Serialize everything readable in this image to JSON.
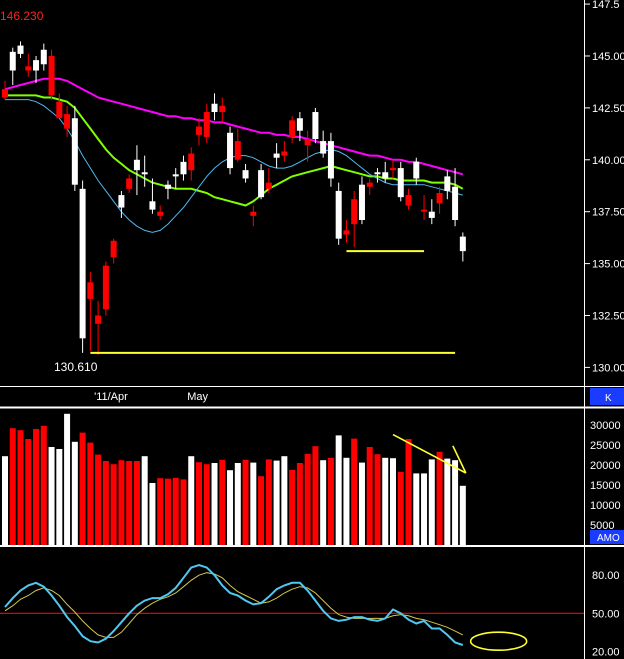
{
  "chart_data": [
    {
      "type": "candlestick",
      "title": "",
      "y_ticks": [
        "147.5",
        "145.00",
        "142.50",
        "140.00",
        "137.50",
        "135.00",
        "132.50",
        "130.00"
      ],
      "y_tick_values": [
        147.5,
        145.0,
        142.5,
        140.0,
        137.5,
        135.0,
        132.5,
        130.0
      ],
      "ylim": [
        129.2,
        147.6
      ],
      "x_labels": [
        "'11/Apr",
        "May"
      ],
      "x_label_bars": [
        12,
        24
      ],
      "annotations": {
        "high": "146.230",
        "low": "130.610"
      },
      "candles": [
        {
          "o": 143.4,
          "h": 143.8,
          "l": 142.9,
          "c": 143.0,
          "up": false
        },
        {
          "o": 144.3,
          "h": 145.4,
          "l": 143.6,
          "c": 145.2,
          "up": true
        },
        {
          "o": 145.1,
          "h": 145.7,
          "l": 144.9,
          "c": 145.5,
          "up": true
        },
        {
          "o": 144.3,
          "h": 145.1,
          "l": 144.0,
          "c": 144.5,
          "up": false
        },
        {
          "o": 144.3,
          "h": 145.0,
          "l": 143.7,
          "c": 144.8,
          "up": true
        },
        {
          "o": 144.6,
          "h": 145.6,
          "l": 144.3,
          "c": 145.3,
          "up": true
        },
        {
          "o": 145.0,
          "h": 145.3,
          "l": 142.9,
          "c": 143.1,
          "up": false
        },
        {
          "o": 142.8,
          "h": 143.2,
          "l": 142.7,
          "c": 142.0,
          "up": false
        },
        {
          "o": 142.2,
          "h": 142.6,
          "l": 141.1,
          "c": 141.5,
          "up": false
        },
        {
          "o": 142.0,
          "h": 142.6,
          "l": 138.5,
          "c": 138.8,
          "up": true
        },
        {
          "o": 138.6,
          "h": 139.0,
          "l": 130.7,
          "c": 131.4,
          "up": true
        },
        {
          "o": 134.1,
          "h": 134.6,
          "l": 130.8,
          "c": 133.3,
          "up": false
        },
        {
          "o": 132.5,
          "h": 133.2,
          "l": 130.6,
          "c": 132.1,
          "up": false
        },
        {
          "o": 132.8,
          "h": 135.1,
          "l": 132.5,
          "c": 134.9,
          "up": false
        },
        {
          "o": 135.3,
          "h": 136.2,
          "l": 135.0,
          "c": 136.1,
          "up": false
        },
        {
          "o": 137.7,
          "h": 138.5,
          "l": 137.2,
          "c": 138.3,
          "up": true
        },
        {
          "o": 138.6,
          "h": 139.3,
          "l": 138.4,
          "c": 139.1,
          "up": false
        },
        {
          "o": 140.0,
          "h": 140.7,
          "l": 138.3,
          "c": 139.5,
          "up": true
        },
        {
          "o": 139.3,
          "h": 140.2,
          "l": 138.7,
          "c": 139.4,
          "up": true
        },
        {
          "o": 138.0,
          "h": 139.1,
          "l": 137.4,
          "c": 137.6,
          "up": true
        },
        {
          "o": 137.5,
          "h": 137.8,
          "l": 137.1,
          "c": 137.3,
          "up": false
        },
        {
          "o": 138.6,
          "h": 139.0,
          "l": 138.1,
          "c": 138.8,
          "up": true
        },
        {
          "o": 139.2,
          "h": 139.6,
          "l": 138.6,
          "c": 139.3,
          "up": true
        },
        {
          "o": 139.3,
          "h": 140.2,
          "l": 139.0,
          "c": 139.9,
          "up": true
        },
        {
          "o": 139.5,
          "h": 140.6,
          "l": 139.0,
          "c": 140.3,
          "up": false
        },
        {
          "o": 141.2,
          "h": 142.0,
          "l": 140.7,
          "c": 141.6,
          "up": false
        },
        {
          "o": 141.1,
          "h": 142.7,
          "l": 140.8,
          "c": 142.3,
          "up": false
        },
        {
          "o": 142.3,
          "h": 143.2,
          "l": 141.9,
          "c": 142.7,
          "up": true
        },
        {
          "o": 142.6,
          "h": 143.0,
          "l": 141.8,
          "c": 142.3,
          "up": false
        },
        {
          "o": 139.6,
          "h": 141.6,
          "l": 139.3,
          "c": 141.3,
          "up": true
        },
        {
          "o": 140.9,
          "h": 141.5,
          "l": 139.9,
          "c": 140.0,
          "up": false
        },
        {
          "o": 139.1,
          "h": 139.8,
          "l": 138.9,
          "c": 139.5,
          "up": true
        },
        {
          "o": 137.5,
          "h": 137.8,
          "l": 136.8,
          "c": 137.3,
          "up": false
        },
        {
          "o": 138.2,
          "h": 139.8,
          "l": 138.1,
          "c": 139.5,
          "up": true
        },
        {
          "o": 138.9,
          "h": 139.6,
          "l": 138.4,
          "c": 138.6,
          "up": false
        },
        {
          "o": 140.1,
          "h": 140.8,
          "l": 139.6,
          "c": 140.3,
          "up": true
        },
        {
          "o": 140.4,
          "h": 140.9,
          "l": 139.9,
          "c": 140.2,
          "up": false
        },
        {
          "o": 141.1,
          "h": 142.1,
          "l": 140.8,
          "c": 141.9,
          "up": false
        },
        {
          "o": 141.4,
          "h": 142.3,
          "l": 140.9,
          "c": 142.0,
          "up": true
        },
        {
          "o": 140.7,
          "h": 141.4,
          "l": 139.9,
          "c": 141.0,
          "up": false
        },
        {
          "o": 141.0,
          "h": 142.5,
          "l": 140.8,
          "c": 142.3,
          "up": true
        },
        {
          "o": 140.3,
          "h": 141.4,
          "l": 140.1,
          "c": 140.9,
          "up": true
        },
        {
          "o": 140.9,
          "h": 141.3,
          "l": 138.7,
          "c": 139.1,
          "up": true
        },
        {
          "o": 138.5,
          "h": 138.9,
          "l": 135.9,
          "c": 136.2,
          "up": true
        },
        {
          "o": 136.6,
          "h": 137.1,
          "l": 136.0,
          "c": 136.4,
          "up": false
        },
        {
          "o": 138.1,
          "h": 138.5,
          "l": 135.8,
          "c": 136.9,
          "up": false
        },
        {
          "o": 137.1,
          "h": 139.2,
          "l": 136.9,
          "c": 138.8,
          "up": true
        },
        {
          "o": 138.7,
          "h": 139.1,
          "l": 138.3,
          "c": 138.9,
          "up": false
        },
        {
          "o": 139.3,
          "h": 139.6,
          "l": 138.9,
          "c": 139.4,
          "up": true
        },
        {
          "o": 139.4,
          "h": 139.9,
          "l": 138.9,
          "c": 139.1,
          "up": true
        },
        {
          "o": 139.6,
          "h": 140.0,
          "l": 139.1,
          "c": 139.5,
          "up": false
        },
        {
          "o": 139.6,
          "h": 139.9,
          "l": 138.0,
          "c": 138.2,
          "up": true
        },
        {
          "o": 138.3,
          "h": 138.6,
          "l": 137.6,
          "c": 137.8,
          "up": false
        },
        {
          "o": 139.1,
          "h": 140.1,
          "l": 138.8,
          "c": 139.9,
          "up": true
        },
        {
          "o": 137.6,
          "h": 138.3,
          "l": 137.1,
          "c": 137.5,
          "up": false
        },
        {
          "o": 137.5,
          "h": 138.1,
          "l": 136.9,
          "c": 137.2,
          "up": true
        },
        {
          "o": 138.4,
          "h": 138.7,
          "l": 137.4,
          "c": 137.9,
          "up": false
        },
        {
          "o": 139.2,
          "h": 139.5,
          "l": 138.1,
          "c": 138.5,
          "up": true
        },
        {
          "o": 138.7,
          "h": 139.6,
          "l": 136.8,
          "c": 137.1,
          "up": true
        },
        {
          "o": 136.3,
          "h": 136.5,
          "l": 135.1,
          "c": 135.6,
          "up": true
        }
      ],
      "moving_averages": [
        {
          "color": "#ff00ff",
          "values": [
            143.4,
            143.5,
            143.6,
            143.7,
            143.8,
            143.9,
            143.9,
            143.9,
            143.8,
            143.6,
            143.4,
            143.2,
            143.0,
            142.9,
            142.8,
            142.7,
            142.6,
            142.5,
            142.4,
            142.3,
            142.2,
            142.1,
            142.1,
            142.0,
            142.0,
            141.9,
            141.9,
            141.8,
            141.8,
            141.7,
            141.6,
            141.5,
            141.4,
            141.3,
            141.3,
            141.2,
            141.2,
            141.1,
            141.1,
            141.0,
            140.9,
            140.8,
            140.7,
            140.6,
            140.5,
            140.4,
            140.3,
            140.2,
            140.2,
            140.1,
            140.0,
            140.0,
            139.9,
            139.9,
            139.8,
            139.7,
            139.6,
            139.5,
            139.4,
            139.3
          ]
        },
        {
          "color": "#80ff00",
          "values": [
            143.1,
            143.1,
            143.1,
            143.1,
            143.1,
            143.0,
            143.0,
            142.9,
            142.8,
            142.5,
            142.0,
            141.5,
            141.0,
            140.5,
            140.1,
            139.8,
            139.5,
            139.3,
            139.1,
            138.9,
            138.8,
            138.7,
            138.6,
            138.6,
            138.6,
            138.5,
            138.4,
            138.2,
            138.1,
            138.0,
            137.9,
            137.8,
            138.0,
            138.3,
            138.6,
            138.8,
            139.0,
            139.2,
            139.3,
            139.4,
            139.5,
            139.6,
            139.7,
            139.6,
            139.5,
            139.4,
            139.3,
            139.2,
            139.2,
            139.1,
            139.1,
            139.0,
            139.0,
            139.0,
            139.0,
            138.9,
            138.9,
            138.9,
            138.8,
            138.6
          ]
        },
        {
          "color": "#50b8f0",
          "values": [
            142.9,
            142.9,
            142.9,
            142.9,
            142.8,
            142.6,
            142.3,
            142.0,
            141.5,
            140.9,
            140.2,
            139.6,
            139.0,
            138.5,
            138.0,
            137.5,
            137.1,
            136.8,
            136.6,
            136.5,
            136.6,
            136.9,
            137.3,
            137.7,
            138.2,
            138.7,
            139.2,
            139.6,
            139.9,
            140.1,
            140.2,
            140.2,
            140.1,
            139.9,
            139.7,
            139.6,
            139.6,
            139.7,
            139.9,
            140.1,
            140.3,
            140.4,
            140.5,
            140.4,
            140.2,
            139.9,
            139.6,
            139.3,
            139.1,
            138.9,
            138.8,
            138.8,
            138.8,
            138.8,
            138.8,
            138.7,
            138.6,
            138.5,
            138.4,
            138.3
          ]
        }
      ],
      "support_lines": [
        {
          "color": "#ffff33",
          "from_bar": 11,
          "to_bar": 58,
          "value": 130.7
        },
        {
          "color": "#ffff33",
          "from_bar": 44,
          "to_bar": 54,
          "value": 135.6
        }
      ]
    },
    {
      "type": "bar",
      "label": "AMO",
      "y_ticks": [
        "30000",
        "25000",
        "20000",
        "15000",
        "10000",
        "5000"
      ],
      "y_tick_values": [
        30000,
        25000,
        20000,
        15000,
        10000,
        5000
      ],
      "ylim": [
        0,
        33000
      ],
      "volume": [
        22200,
        29200,
        28700,
        26500,
        29000,
        29800,
        24500,
        24000,
        32800,
        25800,
        28100,
        25600,
        22600,
        21000,
        20200,
        21200,
        21000,
        21000,
        22200,
        15500,
        16700,
        16600,
        16800,
        16400,
        22200,
        20700,
        20200,
        20500,
        21300,
        18700,
        20500,
        21300,
        20600,
        17200,
        21400,
        21100,
        22200,
        18800,
        20500,
        22800,
        24700,
        21200,
        21800,
        27400,
        21800,
        26600,
        20600,
        24500,
        22700,
        21800,
        21700,
        18300,
        26500,
        17900,
        17900,
        21400,
        23300,
        21600,
        21200,
        14800
      ],
      "volume_up": [
        true,
        false,
        false,
        false,
        false,
        false,
        true,
        true,
        true,
        true,
        false,
        false,
        false,
        false,
        false,
        false,
        false,
        false,
        true,
        true,
        false,
        false,
        false,
        false,
        true,
        false,
        false,
        true,
        false,
        true,
        true,
        false,
        true,
        false,
        false,
        true,
        true,
        false,
        false,
        false,
        false,
        true,
        false,
        true,
        true,
        false,
        true,
        false,
        false,
        true,
        true,
        false,
        false,
        true,
        true,
        true,
        false,
        true,
        true,
        true
      ],
      "trendline_color": "#ffff33",
      "trendline_bars": [
        50,
        59
      ],
      "trendline_values": [
        27600,
        17500
      ]
    },
    {
      "type": "line",
      "y_ticks": [
        "80.00",
        "50.00",
        "20.00"
      ],
      "y_tick_values": [
        80,
        50,
        20
      ],
      "ylim": [
        14,
        92
      ],
      "reference_line": {
        "value": 50,
        "color": "#ff0000"
      },
      "series": [
        {
          "color": "#50c8f0",
          "values": [
            55,
            62,
            68,
            72,
            74,
            71,
            64,
            56,
            47,
            40,
            32,
            28,
            27,
            30,
            36,
            43,
            50,
            56,
            60,
            62,
            62,
            65,
            70,
            78,
            86,
            88,
            86,
            80,
            72,
            66,
            64,
            60,
            57,
            58,
            63,
            69,
            72,
            74,
            74,
            68,
            60,
            52,
            46,
            44,
            45,
            47,
            47,
            45,
            44,
            46,
            53,
            50,
            45,
            42,
            44,
            38,
            38,
            33,
            27,
            25
          ]
        },
        {
          "color": "#d2c850",
          "values": [
            52,
            56,
            61,
            64,
            68,
            70,
            68,
            64,
            57,
            51,
            44,
            38,
            33,
            31,
            31,
            35,
            42,
            49,
            54,
            58,
            61,
            63,
            66,
            71,
            76,
            80,
            82,
            81,
            78,
            72,
            67,
            64,
            61,
            58,
            59,
            62,
            66,
            69,
            71,
            70,
            66,
            60,
            54,
            49,
            47,
            46,
            46,
            46,
            46,
            46,
            48,
            49,
            48,
            46,
            45,
            43,
            41,
            39,
            36,
            33
          ]
        }
      ],
      "ellipse": {
        "color": "#ffff33",
        "bar": 64,
        "value": 28
      }
    }
  ]
}
